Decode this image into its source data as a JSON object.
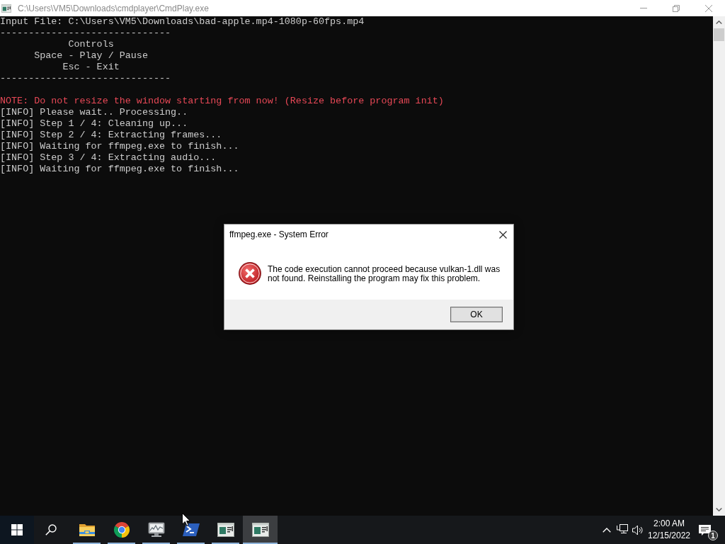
{
  "window": {
    "title": "C:\\Users\\VM5\\Downloads\\cmdplayer\\CmdPlay.exe"
  },
  "console": {
    "lines": [
      {
        "kind": "text",
        "text": "Input File: C:\\Users\\VM5\\Downloads\\bad-apple.mp4-1080p-60fps.mp4"
      },
      {
        "kind": "text",
        "text": "------------------------------"
      },
      {
        "kind": "text",
        "text": "            Controls"
      },
      {
        "kind": "text",
        "text": "      Space - Play / Pause"
      },
      {
        "kind": "text",
        "text": "           Esc - Exit"
      },
      {
        "kind": "text",
        "text": "------------------------------"
      },
      {
        "kind": "blank"
      },
      {
        "kind": "warning",
        "text": "NOTE: Do not resize the window starting from now! (Resize before program init)"
      },
      {
        "kind": "text",
        "text": "[INFO] Please wait.. Processing.."
      },
      {
        "kind": "text",
        "text": "[INFO] Step 1 / 4: Cleaning up..."
      },
      {
        "kind": "text",
        "text": "[INFO] Step 2 / 4: Extracting frames..."
      },
      {
        "kind": "text",
        "text": "[INFO] Waiting for ffmpeg.exe to finish..."
      },
      {
        "kind": "text",
        "text": "[INFO] Step 3 / 4: Extracting audio..."
      },
      {
        "kind": "text",
        "text": "[INFO] Waiting for ffmpeg.exe to finish..."
      }
    ]
  },
  "dialog": {
    "title": "ffmpeg.exe - System Error",
    "message": "The code execution cannot proceed because vulkan-1.dll was not found. Reinstalling the program may fix this problem.",
    "buttons": [
      "OK"
    ]
  },
  "taskbar": {
    "apps": [
      {
        "kind": "folder",
        "running": true,
        "selected": false
      },
      {
        "kind": "browser",
        "running": true,
        "selected": false
      },
      {
        "kind": "monitor",
        "running": true,
        "selected": false
      },
      {
        "kind": "terminal",
        "running": true,
        "selected": false
      },
      {
        "kind": "console",
        "running": true,
        "selected": false
      },
      {
        "kind": "console",
        "running": true,
        "selected": true
      }
    ],
    "clock": {
      "time": "2:00 AM",
      "date": "12/15/2022"
    },
    "notification_count": "1"
  }
}
